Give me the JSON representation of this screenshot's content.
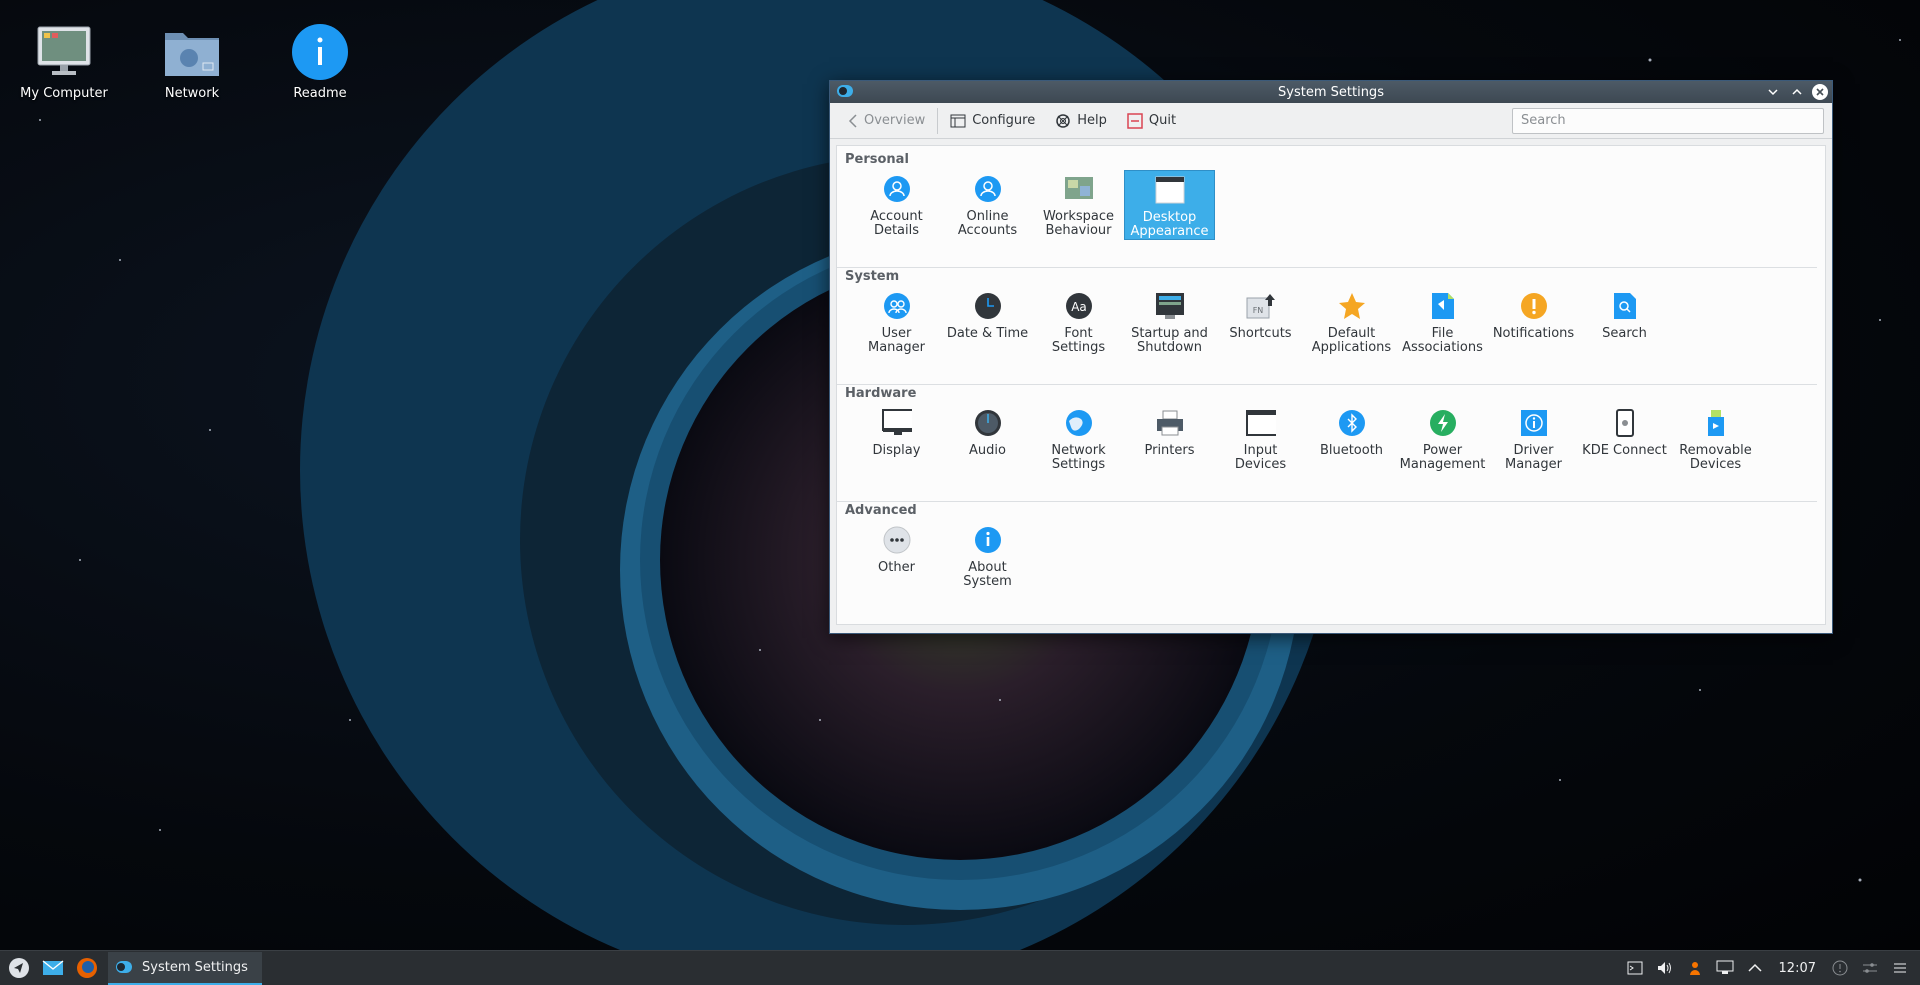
{
  "desktop": {
    "icons": [
      {
        "label": "My Computer",
        "icon": "computer-icon"
      },
      {
        "label": "Network",
        "icon": "network-folder-icon"
      },
      {
        "label": "Readme",
        "icon": "info-icon"
      }
    ]
  },
  "window": {
    "title": "System Settings",
    "toolbar": {
      "overview": "Overview",
      "configure": "Configure",
      "help": "Help",
      "quit": "Quit",
      "search_placeholder": "Search"
    },
    "sections": [
      {
        "title": "Personal",
        "items": [
          {
            "label": "Account\nDetails",
            "icon": "account-icon"
          },
          {
            "label": "Online\nAccounts",
            "icon": "online-accounts-icon"
          },
          {
            "label": "Workspace\nBehaviour",
            "icon": "workspace-icon"
          },
          {
            "label": "Desktop\nAppearance",
            "icon": "desktop-appearance-icon",
            "selected": true
          }
        ]
      },
      {
        "title": "System",
        "items": [
          {
            "label": "User\nManager",
            "icon": "user-manager-icon"
          },
          {
            "label": "Date & Time",
            "icon": "clock-icon"
          },
          {
            "label": "Font\nSettings",
            "icon": "font-icon"
          },
          {
            "label": "Startup and\nShutdown",
            "icon": "startup-icon"
          },
          {
            "label": "Shortcuts",
            "icon": "shortcuts-icon"
          },
          {
            "label": "Default\nApplications",
            "icon": "star-icon"
          },
          {
            "label": "File\nAssociations",
            "icon": "file-associations-icon"
          },
          {
            "label": "Notifications",
            "icon": "notifications-icon"
          },
          {
            "label": "Search",
            "icon": "search-icon"
          }
        ]
      },
      {
        "title": "Hardware",
        "items": [
          {
            "label": "Display",
            "icon": "display-icon"
          },
          {
            "label": "Audio",
            "icon": "audio-icon"
          },
          {
            "label": "Network\nSettings",
            "icon": "network-icon"
          },
          {
            "label": "Printers",
            "icon": "printer-icon"
          },
          {
            "label": "Input\nDevices",
            "icon": "input-devices-icon"
          },
          {
            "label": "Bluetooth",
            "icon": "bluetooth-icon"
          },
          {
            "label": "Power\nManagement",
            "icon": "power-icon"
          },
          {
            "label": "Driver\nManager",
            "icon": "driver-icon"
          },
          {
            "label": "KDE Connect",
            "icon": "kde-connect-icon"
          },
          {
            "label": "Removable\nDevices",
            "icon": "usb-icon"
          }
        ]
      },
      {
        "title": "Advanced",
        "items": [
          {
            "label": "Other",
            "icon": "other-icon"
          },
          {
            "label": "About\nSystem",
            "icon": "about-icon"
          }
        ]
      }
    ]
  },
  "taskbar": {
    "task_label": "System Settings",
    "clock": "12:07"
  },
  "colors": {
    "accent": "#3daee9",
    "panel": "#2a2e32",
    "window_bg": "#eff0f1"
  }
}
